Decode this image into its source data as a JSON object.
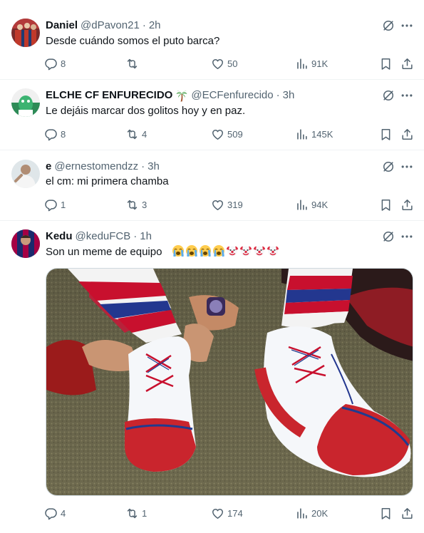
{
  "tweets": [
    {
      "name": "Daniel",
      "handle": "@dPavon21",
      "time": "2h",
      "text": "Desde cuándo somos el puto barca?",
      "replies": "8",
      "reposts": "",
      "likes": "50",
      "views": "91K"
    },
    {
      "name": "ELCHE CF ENFURECIDO",
      "name_emoji": "palm-tree",
      "handle": "@ECFenfurecido",
      "time": "3h",
      "text": "Le dejáis marcar dos golitos hoy y en paz.",
      "replies": "8",
      "reposts": "4",
      "likes": "509",
      "views": "145K"
    },
    {
      "name": "e",
      "handle": "@ernestomendzz",
      "time": "3h",
      "text": "el cm: mi primera chamba",
      "replies": "1",
      "reposts": "3",
      "likes": "319",
      "views": "94K"
    },
    {
      "name": "Kedu",
      "handle": "@keduFCB",
      "time": "1h",
      "text": "Son un meme de equipo",
      "text_emojis": [
        "loudly-crying-face",
        "loudly-crying-face",
        "loudly-crying-face",
        "loudly-crying-face",
        "clown-face",
        "clown-face",
        "clown-face",
        "clown-face"
      ],
      "media": "photo of a person tying the laces of oversized red and white clown shoes while wearing red, white and blue striped socks",
      "replies": "4",
      "reposts": "1",
      "likes": "174",
      "views": "20K"
    }
  ],
  "icons": {
    "reply": "reply-icon",
    "repost": "repost-icon",
    "like": "heart-icon",
    "views": "views-icon",
    "bookmark": "bookmark-icon",
    "share": "share-icon",
    "grok": "grok-icon",
    "more": "more-icon"
  },
  "colors": {
    "text": "#0f1419",
    "secondary": "#536471",
    "separator": "#eff3f4"
  }
}
